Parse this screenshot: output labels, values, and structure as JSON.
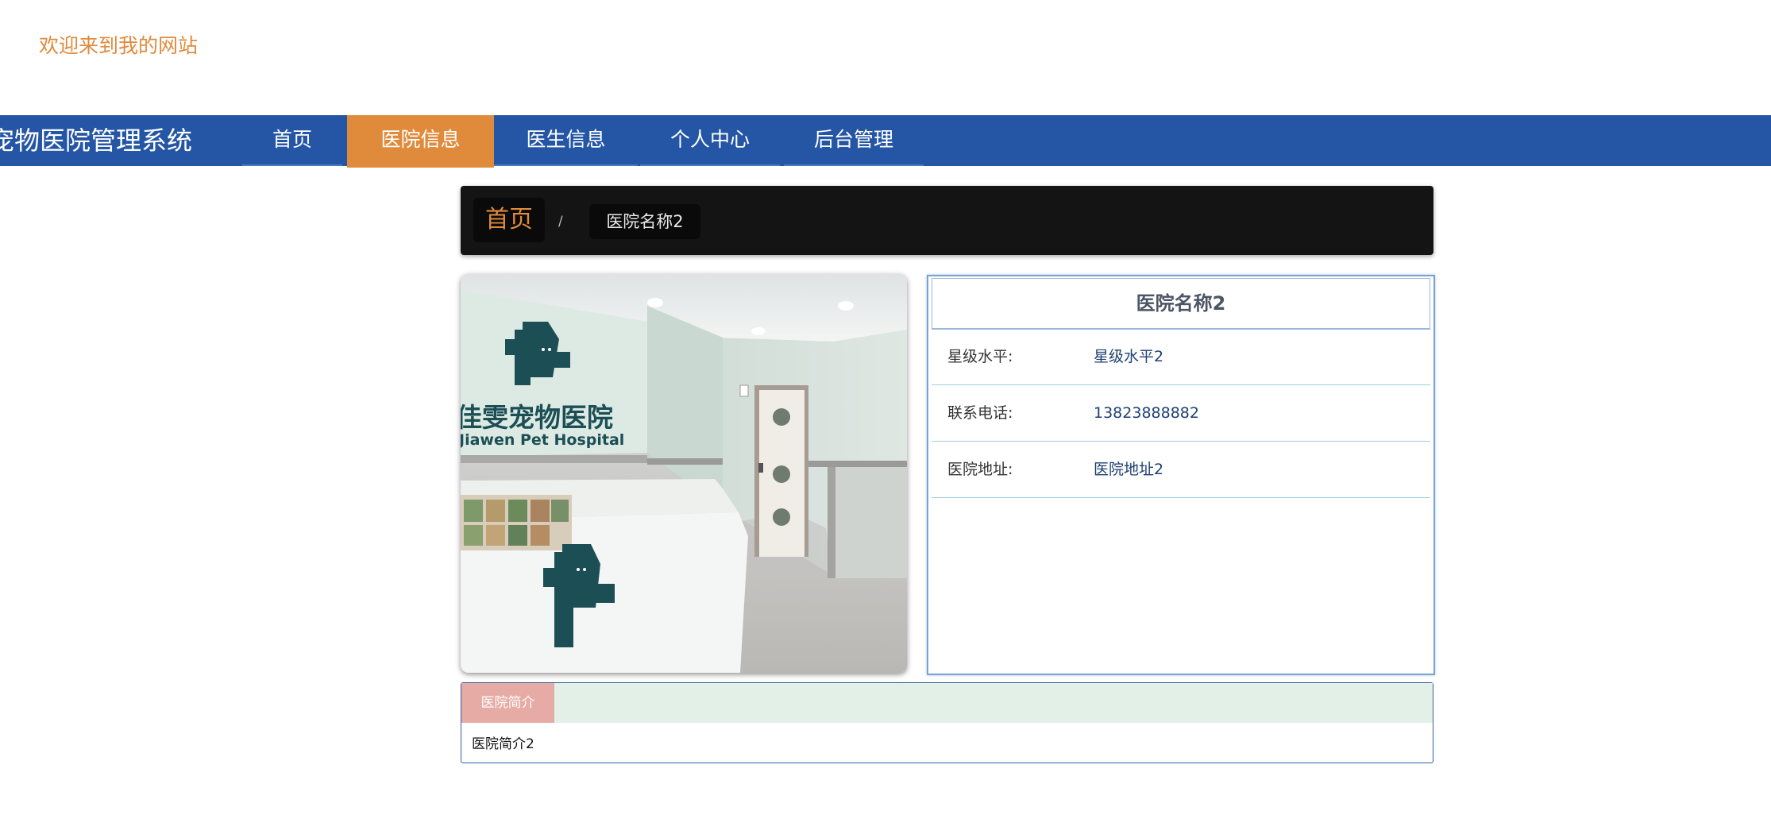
{
  "header": {
    "welcome": "欢迎来到我的网站"
  },
  "nav": {
    "brand": "宠物医院管理系统",
    "items": [
      {
        "label": "首页",
        "active": false
      },
      {
        "label": "医院信息",
        "active": true
      },
      {
        "label": "医生信息",
        "active": false
      },
      {
        "label": "个人中心",
        "active": false
      },
      {
        "label": "后台管理",
        "active": false
      }
    ]
  },
  "breadcrumb": {
    "home": "首页",
    "separator": "/",
    "current": "医院名称2"
  },
  "photo": {
    "sign_cn": "佳雯宠物医院",
    "sign_en": "Jiawen Pet Hospital"
  },
  "detail": {
    "title": "医院名称2",
    "rows": [
      {
        "label": "星级水平:",
        "value": "星级水平2"
      },
      {
        "label": "联系电话:",
        "value": "13823888882"
      },
      {
        "label": "医院地址:",
        "value": "医院地址2"
      }
    ]
  },
  "intro": {
    "tab": "医院简介",
    "text": "医院简介2"
  },
  "colors": {
    "nav_bg": "#2556a5",
    "accent": "#e08a3c",
    "crumb_bg": "#141414",
    "intro_tab": "#e6aba4"
  }
}
